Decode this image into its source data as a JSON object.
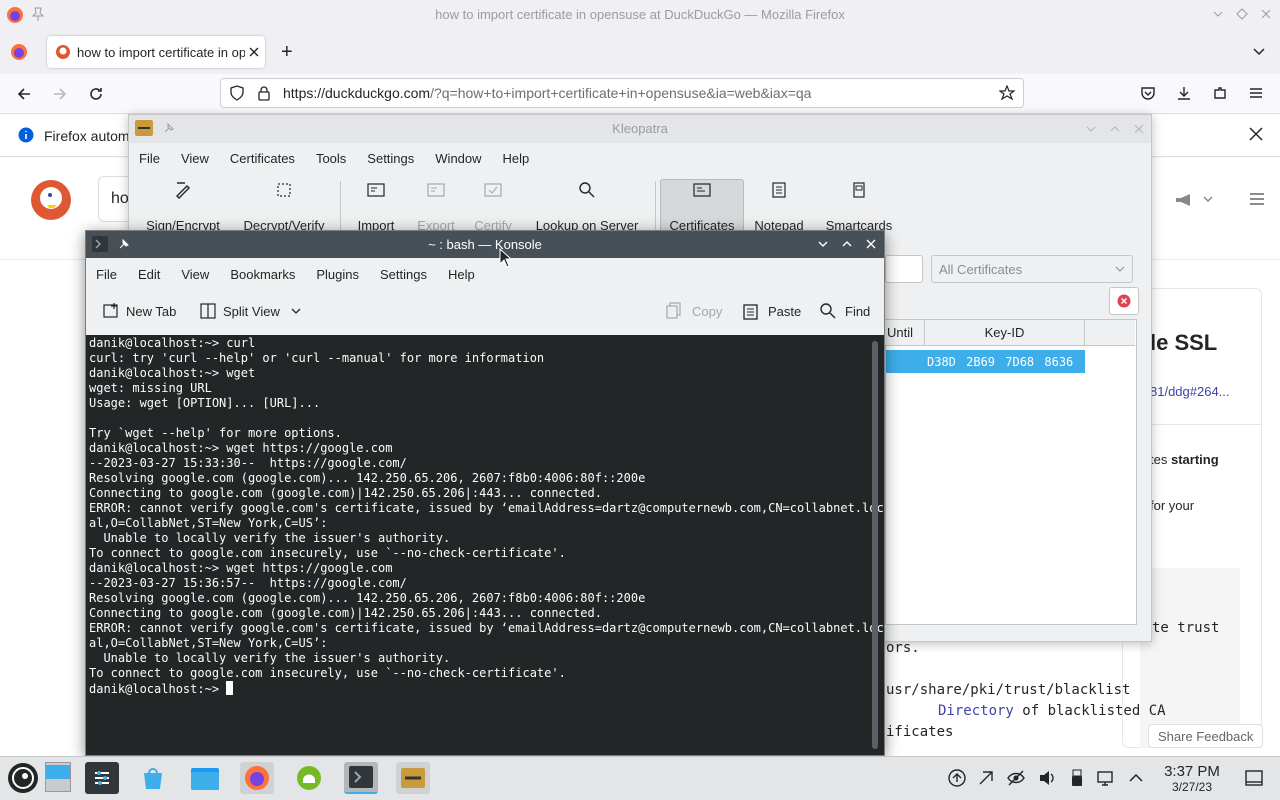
{
  "firefox": {
    "window_title": "how to import certificate in opensuse at DuckDuckGo — Mozilla Firefox",
    "tab_title": "how to import certificate in opensuse at DuckDuckGo",
    "url_host": "https://duckduckgo.com",
    "url_path": "/?q=how+to+import+certificate+in+opensuse&ia=web&iax=qa",
    "notification": "Firefox automatically trusts enterprise root certificates",
    "search_text": "ho"
  },
  "ddg": {
    "heading": "le SSL",
    "link": "81/ddg#264...",
    "snippet1_pre": "tes ",
    "snippet1_bold": "starting",
    "snippet2": "for your",
    "code1": "te trust",
    "code2": "ors.",
    "code3": "usr/share/pki/trust/blacklist",
    "code4_word": "Directory",
    "code4_rest": " of blacklisted CA",
    "code5": "ificates",
    "share_feedback": "Share Feedback"
  },
  "kleopatra": {
    "title": "Kleopatra",
    "menu": [
      "File",
      "View",
      "Certificates",
      "Tools",
      "Settings",
      "Window",
      "Help"
    ],
    "toolbar": {
      "sign": "Sign/Encrypt",
      "decrypt": "Decrypt/Verify",
      "import": "Import",
      "export": "Export",
      "certify": "Certify",
      "lookup": "Lookup on Server",
      "certificates": "Certificates",
      "notepad": "Notepad",
      "smartcards": "Smartcards"
    },
    "filter": "All Certificates",
    "columns": {
      "until": "Until",
      "keyid": "Key-ID"
    },
    "row_keyid": "D38D 2B69 7D68 8636"
  },
  "konsole": {
    "title": "~ : bash — Konsole",
    "menu": [
      "File",
      "Edit",
      "View",
      "Bookmarks",
      "Plugins",
      "Settings",
      "Help"
    ],
    "toolbar": {
      "new_tab": "New Tab",
      "split_view": "Split View",
      "copy": "Copy",
      "paste": "Paste",
      "find": "Find"
    },
    "lines": [
      "danik@localhost:~> curl",
      "curl: try 'curl --help' or 'curl --manual' for more information",
      "danik@localhost:~> wget",
      "wget: missing URL",
      "Usage: wget [OPTION]... [URL]...",
      "",
      "Try `wget --help' for more options.",
      "danik@localhost:~> wget https://google.com",
      "--2023-03-27 15:33:30--  https://google.com/",
      "Resolving google.com (google.com)... 142.250.65.206, 2607:f8b0:4006:80f::200e",
      "Connecting to google.com (google.com)|142.250.65.206|:443... connected.",
      "ERROR: cannot verify google.com's certificate, issued by ‘emailAddress=dartz@computernewb.com,CN=collabnet.loc",
      "al,O=CollabNet,ST=New York,C=US’:",
      "  Unable to locally verify the issuer's authority.",
      "To connect to google.com insecurely, use `--no-check-certificate'.",
      "danik@localhost:~> wget https://google.com",
      "--2023-03-27 15:36:57--  https://google.com/",
      "Resolving google.com (google.com)... 142.250.65.206, 2607:f8b0:4006:80f::200e",
      "Connecting to google.com (google.com)|142.250.65.206|:443... connected.",
      "ERROR: cannot verify google.com's certificate, issued by ‘emailAddress=dartz@computernewb.com,CN=collabnet.loc",
      "al,O=CollabNet,ST=New York,C=US’:",
      "  Unable to locally verify the issuer's authority.",
      "To connect to google.com insecurely, use `--no-check-certificate'."
    ],
    "prompt": "danik@localhost:~> "
  },
  "taskbar": {
    "time": "3:37 PM",
    "date": "3/27/23"
  },
  "colors": {
    "selection": "#3daee9",
    "terminal_bg": "#232627",
    "konsole_titlebar": "#475057"
  }
}
